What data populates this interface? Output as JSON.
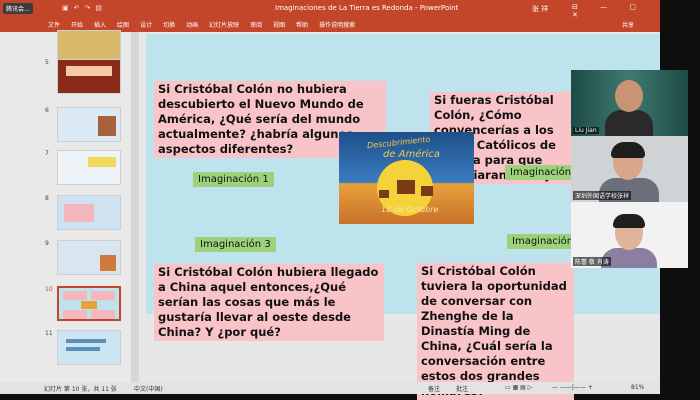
{
  "titlebar": {
    "meeting_label": "腾讯会...",
    "document_title": "Imaginaciones de La Tierra es Redonda - PowerPoint",
    "user_name": "张 祥",
    "window_buttons": "⊟ — ▢ ✕"
  },
  "ribbon": {
    "tabs": [
      "文件",
      "开始",
      "插入",
      "绘图",
      "设计",
      "切换",
      "动画",
      "幻灯片放映",
      "审阅",
      "视图",
      "帮助",
      "操作说明搜索"
    ],
    "share_label": "共享"
  },
  "thumbnails": [
    {
      "number": "5",
      "active": false,
      "bg": "#f4c9a3"
    },
    {
      "number": "6",
      "active": false,
      "bg": "#dbe9f5"
    },
    {
      "number": "7",
      "active": false,
      "bg": "#eef3f8"
    },
    {
      "number": "8",
      "active": false,
      "bg": "#cfe2f2"
    },
    {
      "number": "9",
      "active": false,
      "bg": "#d7e6f1"
    },
    {
      "number": "10",
      "active": true,
      "bg": "#f3d6da"
    },
    {
      "number": "11",
      "active": false,
      "bg": "#cde5f3"
    }
  ],
  "slide": {
    "q1": "Si Cristóbal Colón no hubiera descubierto el Nuevo Mundo de América, ¿Qué sería del mundo actualmente? ¿habría algunos aspectos diferentes?",
    "q2": "Si fueras Cristóbal Colón, ¿Cómo convencerías a los Reyes Católicos de España para que financiaran el viaje?",
    "q3": "Si Cristóbal Colón hubiera llegado a China aquel entonces,¿Qué serían las cosas que más le gustaría llevar al oeste desde China? Y ¿por qué?",
    "q4": "Si Cristóbal Colón tuviera la oportunidad de conversar con Zhenghe de la Dinastía Ming de China, ¿Cuál sería la conversación entre estos dos grandes hombres?",
    "imag1": "Imaginación 1",
    "imag2": "Imaginación 2",
    "imag3": "Imaginación 3",
    "imag4": "Imaginación 4",
    "poster_word1": "Descubrimiento",
    "poster_word2": "de América",
    "poster_date": "12 de Octubre"
  },
  "participants": [
    {
      "name": "Liu Jian"
    },
    {
      "name": "深圳外国语学校张祥"
    },
    {
      "name": "陈蕾 敬 肖涛"
    }
  ],
  "statusbar": {
    "slide_counter": "幻灯片 第 10 张，共 11 张",
    "language": "中文(中国)",
    "notes": "备注",
    "comments": "批注",
    "zoom": "81%"
  },
  "colors": {
    "accent": "#c4462a",
    "slide_bg": "#bfe3ed",
    "question_box": "#f9c4c8",
    "imagination_box": "#9bd27a"
  }
}
